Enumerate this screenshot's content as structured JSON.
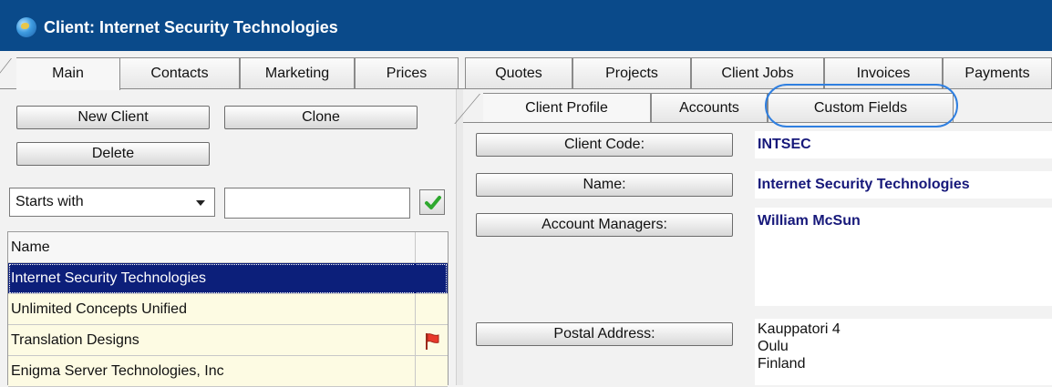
{
  "window": {
    "title": "Client: Internet Security Technologies"
  },
  "main_tabs": [
    "Main",
    "Contacts",
    "Marketing",
    "Prices",
    "Quotes",
    "Projects",
    "Client Jobs",
    "Invoices",
    "Payments"
  ],
  "toolbar": {
    "new_client": "New Client",
    "clone": "Clone",
    "delete": "Delete"
  },
  "filter": {
    "mode": "Starts with",
    "search_value": ""
  },
  "client_list": {
    "header": "Name",
    "rows": [
      {
        "name": "Internet Security Technologies",
        "selected": true,
        "flag": false
      },
      {
        "name": "Unlimited Concepts Unified",
        "selected": false,
        "flag": false
      },
      {
        "name": "Translation Designs",
        "selected": false,
        "flag": true
      },
      {
        "name": "Enigma Server Technologies, Inc",
        "selected": false,
        "flag": false
      }
    ]
  },
  "sub_tabs": [
    "Client Profile",
    "Accounts",
    "Custom Fields"
  ],
  "profile": {
    "client_code_label": "Client Code:",
    "client_code": "INTSEC",
    "name_label": "Name:",
    "name": "Internet Security Technologies",
    "account_managers_label": "Account Managers:",
    "account_managers": "William McSun",
    "postal_address_label": "Postal Address:",
    "postal_address": [
      "Kauppatori 4",
      "Oulu",
      "Finland"
    ]
  },
  "colors": {
    "title_bar": "#0a4a8a",
    "selected_row": "#0c1f7a",
    "row_background": "#fdfbe3",
    "value_text": "#16187a",
    "highlight_ring": "#2f7fe0"
  }
}
